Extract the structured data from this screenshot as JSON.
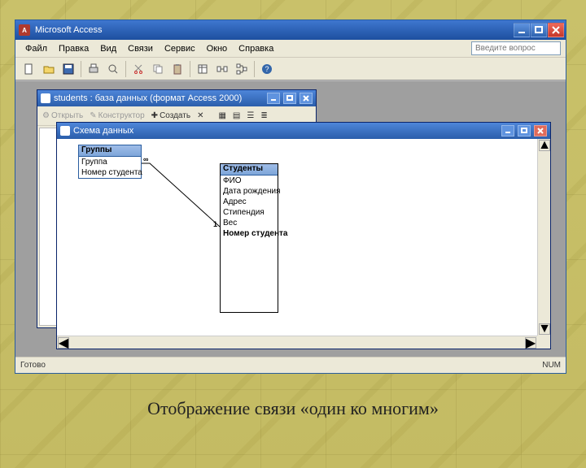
{
  "app": {
    "title": "Microsoft Access"
  },
  "menu": {
    "items": [
      "Файл",
      "Правка",
      "Вид",
      "Связи",
      "Сервис",
      "Окно",
      "Справка"
    ],
    "help_placeholder": "Введите вопрос"
  },
  "db_window": {
    "title": "students : база данных (формат Access 2000)",
    "toolbar": {
      "open": "Открыть",
      "design": "Конструктор",
      "create": "Создать"
    }
  },
  "schema_window": {
    "title": "Схема данных"
  },
  "tables": {
    "group": {
      "name": "Группы",
      "fields": [
        "Группа",
        "Номер студента"
      ]
    },
    "student": {
      "name": "Студенты",
      "fields": [
        "ФИО",
        "Дата рождения",
        "Адрес",
        "Стипендия",
        "Вес",
        "Номер студента"
      ]
    }
  },
  "relation": {
    "left_mark": "∞",
    "right_mark": "1"
  },
  "status": {
    "ready": "Готово",
    "indicator": "NUM"
  },
  "caption": "Отображение связи «один ко многим»"
}
